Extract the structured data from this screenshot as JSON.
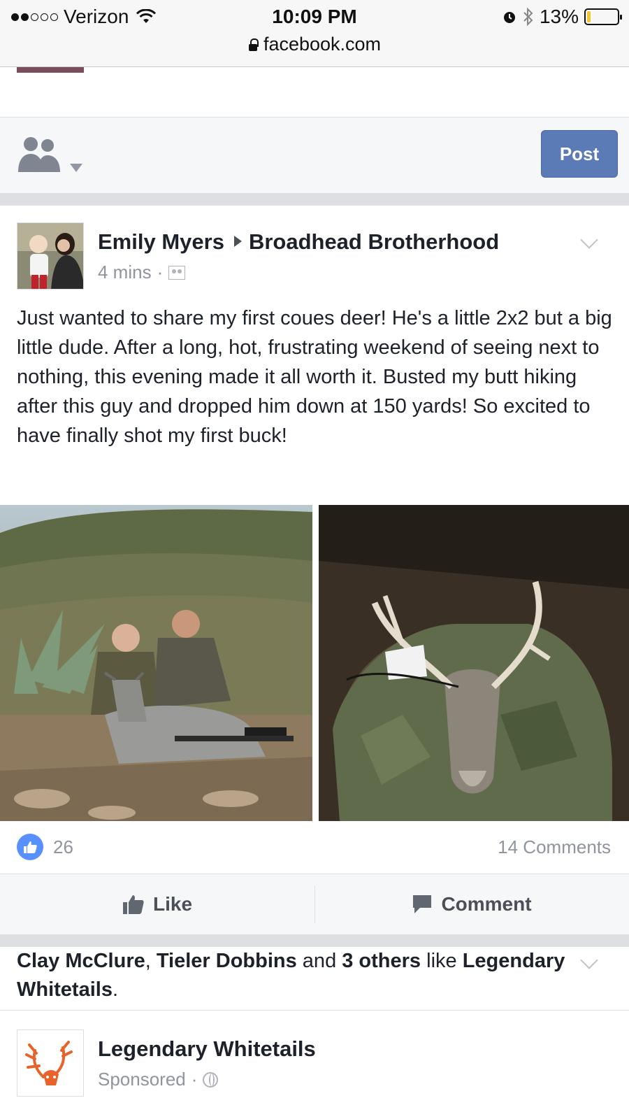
{
  "status_bar": {
    "carrier": "Verizon",
    "time": "10:09 PM",
    "battery_percent": "13%",
    "battery_level": 0.13,
    "url": "facebook.com"
  },
  "composer": {
    "post_label": "Post",
    "audience_icon": "friends-audience-icon"
  },
  "post": {
    "author": "Emily Myers",
    "group": "Broadhead Brotherhood",
    "time_ago": "4 mins",
    "separator": "·",
    "text": "Just wanted to share my first coues deer! He's a little 2x2 but a big little dude. After a long, hot, frustrating weekend of seeing next to nothing, this evening made it all worth it. Busted my butt hiking after this guy and dropped him down at 150 yards! So excited to have finally shot my first buck!",
    "likes": "26",
    "comments": "14 Comments",
    "like_label": "Like",
    "comment_label": "Comment"
  },
  "suggestion": {
    "name1": "Clay McClure",
    "sep1": ", ",
    "name2": "Tieler Dobbins",
    "and": " and ",
    "others": "3 others",
    "like_word": " like ",
    "page": "Legendary Whitetails",
    "period": "."
  },
  "sponsored": {
    "page_name": "Legendary Whitetails",
    "label": "Sponsored",
    "separator": "·"
  },
  "colors": {
    "facebook_blue": "#5b7bb6",
    "like_blue": "#5890ff",
    "meta_gray": "#90949c",
    "battery_yellow": "#f4c430",
    "logo_orange": "#e8632b"
  }
}
